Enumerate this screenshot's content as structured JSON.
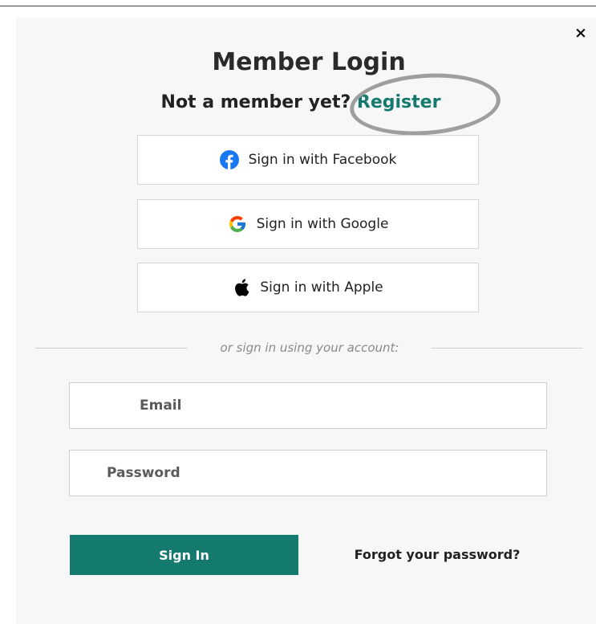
{
  "modal": {
    "close_label": "×",
    "title": "Member Login",
    "subtitle_prefix": "Not a member yet?",
    "register_label": "Register"
  },
  "social_buttons": [
    {
      "label": "Sign in with Facebook",
      "icon": "facebook-icon",
      "color": "#1877f2"
    },
    {
      "label": "Sign in with Google",
      "icon": "google-icon"
    },
    {
      "label": "Sign in with Apple",
      "icon": "apple-icon",
      "color": "#000000"
    }
  ],
  "divider": {
    "text": "or sign in using your account:"
  },
  "form": {
    "email_placeholder": "Email",
    "password_placeholder": "Password",
    "signin_label": "Sign In",
    "forgot_label": "Forgot your password?"
  },
  "colors": {
    "accent": "#157a6e",
    "highlight_ring": "#9e9e9e"
  }
}
